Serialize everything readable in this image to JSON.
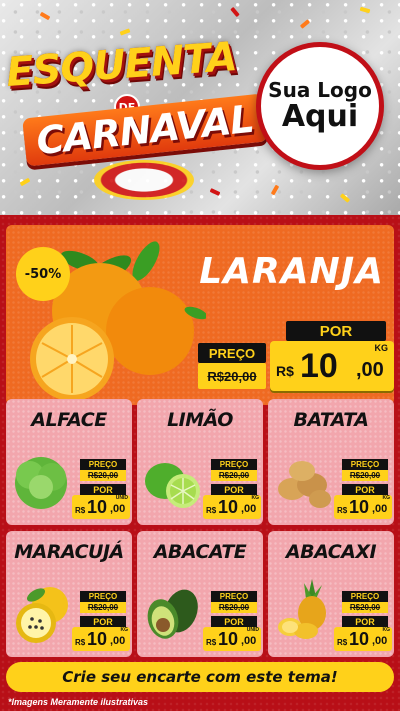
{
  "header": {
    "logo_line1": "ESQUENTA",
    "logo_line2": "DE",
    "logo_line3": "CARNAVAL",
    "badge_line1": "Sua Logo",
    "badge_line2": "Aqui"
  },
  "featured": {
    "discount": "-50%",
    "name": "LARANJA",
    "image_icon": "orange-fruit-icon",
    "preco_label": "PREÇO",
    "old_price": "R$20,00",
    "por_label": "POR",
    "currency": "R$",
    "price_int": "10",
    "price_dec": ",00",
    "unit": "KG"
  },
  "products": [
    {
      "name": "ALFACE",
      "icon": "lettuce-icon",
      "preco_label": "PREÇO",
      "old_price": "R$20,00",
      "por_label": "POR",
      "currency": "R$",
      "price_int": "10",
      "price_dec": ",00",
      "unit": "UNID"
    },
    {
      "name": "LIMÃO",
      "icon": "lime-icon",
      "preco_label": "PREÇO",
      "old_price": "R$20,00",
      "por_label": "POR",
      "currency": "R$",
      "price_int": "10",
      "price_dec": ",00",
      "unit": "KG"
    },
    {
      "name": "BATATA",
      "icon": "potato-icon",
      "preco_label": "PREÇO",
      "old_price": "R$20,00",
      "por_label": "POR",
      "currency": "R$",
      "price_int": "10",
      "price_dec": ",00",
      "unit": "KG"
    },
    {
      "name": "MARACUJÁ",
      "icon": "passion-fruit-icon",
      "preco_label": "PREÇO",
      "old_price": "R$20,00",
      "por_label": "POR",
      "currency": "R$",
      "price_int": "10",
      "price_dec": ",00",
      "unit": "KG"
    },
    {
      "name": "ABACATE",
      "icon": "avocado-icon",
      "preco_label": "PREÇO",
      "old_price": "R$20,00",
      "por_label": "POR",
      "currency": "R$",
      "price_int": "10",
      "price_dec": ",00",
      "unit": "UNID"
    },
    {
      "name": "ABACAXI",
      "icon": "pineapple-icon",
      "preco_label": "PREÇO",
      "old_price": "R$20,00",
      "por_label": "POR",
      "currency": "R$",
      "price_int": "10",
      "price_dec": ",00",
      "unit": "KG"
    }
  ],
  "footer": {
    "cta": "Crie seu encarte com este tema!",
    "disclaimer": "*Imagens Meramente ilustrativas"
  },
  "colors": {
    "background_red": "#b80f17",
    "featured_orange": "#ef6a22",
    "card_pink": "#f2a6ad",
    "price_yellow": "#ffd11a",
    "tag_black": "#111111"
  }
}
